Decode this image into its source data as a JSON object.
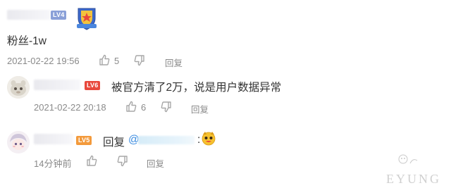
{
  "comments": [
    {
      "level": "LV4",
      "level_color": "#8aa0d8",
      "text": "粉丝-1w",
      "timestamp": "2021-02-22 19:56",
      "likes": "5",
      "reply_label": "回复",
      "has_medal": true
    },
    {
      "level": "LV6",
      "level_color": "#e8483c",
      "text": "被官方清了2万，说是用户数据异常",
      "timestamp": "2021-02-22 20:18",
      "likes": "6",
      "reply_label": "回复"
    },
    {
      "level": "LV5",
      "level_color": "#f39a3c",
      "reply_prefix": "回复",
      "mention_prefix": "@",
      "mention_suffix": ":",
      "timestamp": "14分钟前",
      "reply_label": "回复"
    }
  ],
  "watermark": "EYUNG",
  "colors": {
    "meta_gray": "#8a8a8a",
    "mention_blue": "#3a8be0",
    "icon_gray": "#a7a7a7"
  }
}
